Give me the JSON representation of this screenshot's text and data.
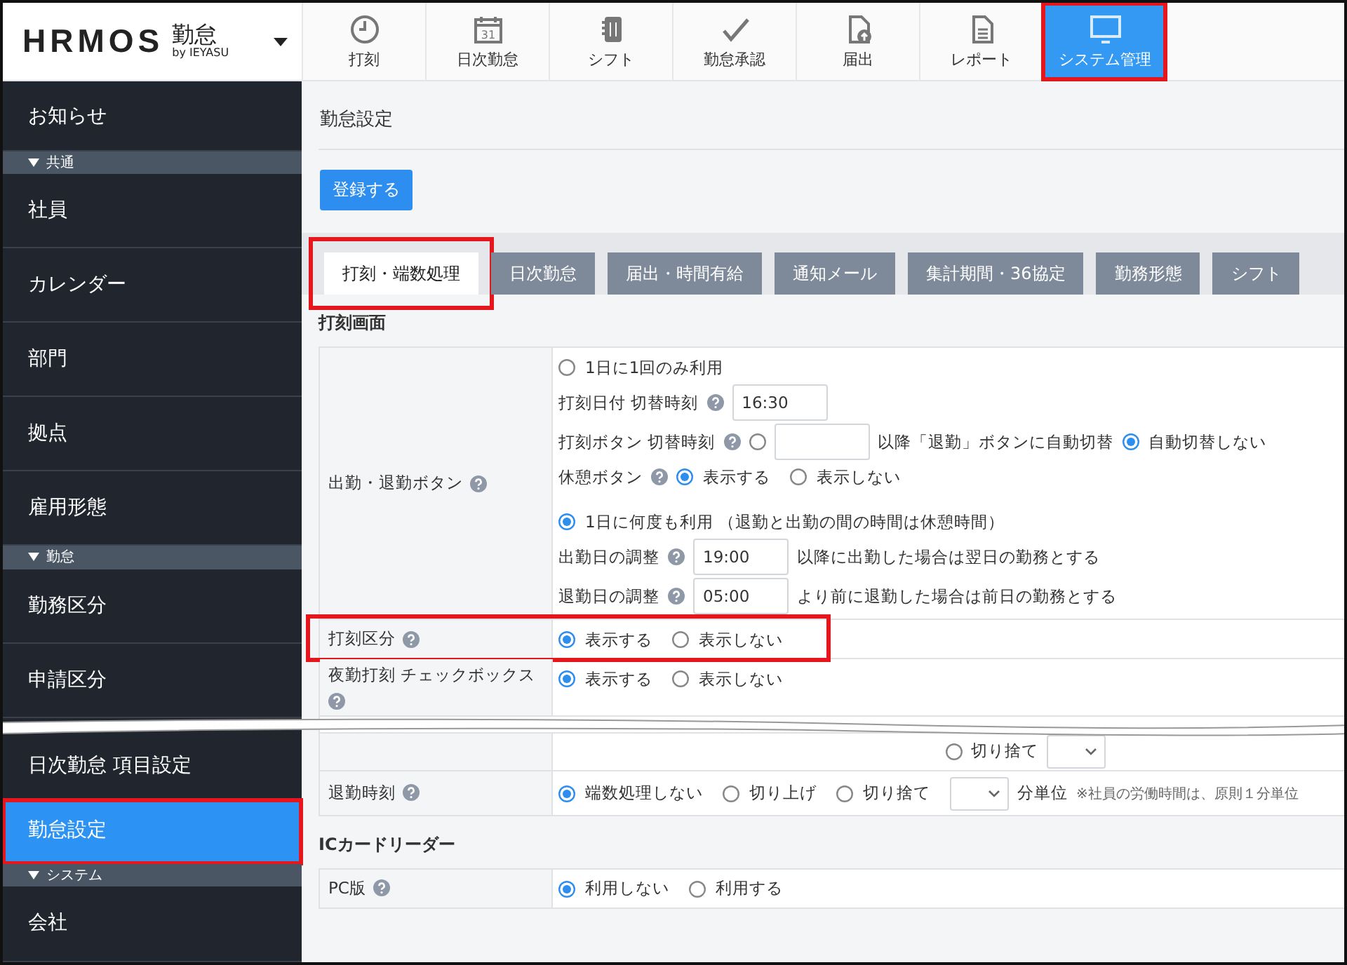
{
  "header": {
    "logo": {
      "brand": "HRMOS",
      "product": "勤怠",
      "by": "by IEYASU"
    },
    "nav": [
      {
        "kind": "clock",
        "label": "打刻",
        "selected": false,
        "highlighted": false
      },
      {
        "kind": "calendar",
        "label": "日次勤怠",
        "icon_text": "31",
        "selected": false,
        "highlighted": false
      },
      {
        "kind": "notebook",
        "label": "シフト",
        "selected": false,
        "highlighted": false
      },
      {
        "kind": "check",
        "label": "勤怠承認",
        "selected": false,
        "highlighted": false
      },
      {
        "kind": "upload",
        "label": "届出",
        "selected": false,
        "highlighted": false
      },
      {
        "kind": "document",
        "label": "レポート",
        "selected": false,
        "highlighted": false
      },
      {
        "kind": "monitor",
        "label": "システム管理",
        "selected": true,
        "highlighted": true
      }
    ]
  },
  "sidebar": {
    "items": [
      {
        "kind": "item",
        "label": "お知らせ",
        "selected": false,
        "highlighted": false
      },
      {
        "kind": "section",
        "label": "共通"
      },
      {
        "kind": "item",
        "label": "社員",
        "selected": false,
        "highlighted": false
      },
      {
        "kind": "item",
        "label": "カレンダー",
        "selected": false,
        "highlighted": false
      },
      {
        "kind": "item",
        "label": "部門",
        "selected": false,
        "highlighted": false
      },
      {
        "kind": "item",
        "label": "拠点",
        "selected": false,
        "highlighted": false
      },
      {
        "kind": "item",
        "label": "雇用形態",
        "selected": false,
        "highlighted": false
      },
      {
        "kind": "section",
        "label": "勤怠"
      },
      {
        "kind": "item",
        "label": "勤務区分",
        "selected": false,
        "highlighted": false
      },
      {
        "kind": "item",
        "label": "申請区分",
        "selected": false,
        "highlighted": false
      },
      {
        "kind": "break"
      },
      {
        "kind": "item",
        "label": "日次勤怠 項目設定",
        "selected": false,
        "highlighted": false
      },
      {
        "kind": "item",
        "label": "勤怠設定",
        "selected": true,
        "highlighted": true
      },
      {
        "kind": "section",
        "label": "システム"
      },
      {
        "kind": "item",
        "label": "会社",
        "selected": false,
        "highlighted": false
      }
    ]
  },
  "content": {
    "title": "勤怠設定",
    "submit_button": "登録する",
    "tabs": [
      {
        "label": "打刻・端数処理",
        "selected": true,
        "highlighted": true
      },
      {
        "label": "日次勤怠",
        "selected": false,
        "highlighted": false
      },
      {
        "label": "届出・時間有給",
        "selected": false,
        "highlighted": false
      },
      {
        "label": "通知メール",
        "selected": false,
        "highlighted": false
      },
      {
        "label": "集計期間・36協定",
        "selected": false,
        "highlighted": false
      },
      {
        "label": "勤務形態",
        "selected": false,
        "highlighted": false
      },
      {
        "label": "シフト",
        "selected": false,
        "highlighted": false
      }
    ],
    "sections": [
      {
        "title": "打刻画面",
        "rows": [
          {
            "kind": "setting",
            "label": "出勤・退勤ボタン",
            "help": true,
            "lines": [
              [
                {
                  "kind": "radio",
                  "label": "1日に1回のみ利用",
                  "selected": false
                }
              ],
              [
                {
                  "kind": "text",
                  "text": "打刻日付 切替時刻"
                },
                {
                  "kind": "help"
                },
                {
                  "kind": "input",
                  "value": "16:30"
                }
              ],
              [
                {
                  "kind": "text",
                  "text": "打刻ボタン 切替時刻"
                },
                {
                  "kind": "help"
                },
                {
                  "kind": "radio",
                  "selected": false
                },
                {
                  "kind": "input"
                },
                {
                  "kind": "text",
                  "text": "以降「退勤」ボタンに自動切替"
                },
                {
                  "kind": "radio",
                  "label": "自動切替しない",
                  "selected": true
                }
              ],
              [
                {
                  "kind": "text",
                  "text": "休憩ボタン"
                },
                {
                  "kind": "help"
                },
                {
                  "kind": "radio",
                  "label": "表示する",
                  "selected": true
                },
                {
                  "kind": "radio",
                  "label": "表示しない",
                  "selected": false
                }
              ],
              [
                {
                  "kind": "gap"
                }
              ],
              [
                {
                  "kind": "radio",
                  "label": "1日に何度も利用 （退勤と出勤の間の時間は休憩時間）",
                  "selected": true
                }
              ],
              [
                {
                  "kind": "text",
                  "text": "出勤日の調整"
                },
                {
                  "kind": "help"
                },
                {
                  "kind": "input",
                  "value": "19:00"
                },
                {
                  "kind": "text",
                  "text": "以降に出勤した場合は翌日の勤務とする"
                }
              ],
              [
                {
                  "kind": "text",
                  "text": "退勤日の調整"
                },
                {
                  "kind": "help"
                },
                {
                  "kind": "input",
                  "value": "05:00"
                },
                {
                  "kind": "text",
                  "text": "より前に退勤した場合は前日の勤務とする"
                }
              ]
            ]
          },
          {
            "kind": "setting",
            "label": "打刻区分",
            "help": true,
            "highlighted": true,
            "lines": [
              [
                {
                  "kind": "radio",
                  "label": "表示する",
                  "selected": true
                },
                {
                  "kind": "radio",
                  "label": "表示しない",
                  "selected": false
                }
              ]
            ]
          },
          {
            "kind": "setting",
            "label": "夜勤打刻 チェックボックス",
            "help": true,
            "lines": [
              [
                {
                  "kind": "radio",
                  "label": "表示する",
                  "selected": true
                },
                {
                  "kind": "radio",
                  "label": "表示しない",
                  "selected": false
                }
              ]
            ]
          },
          {
            "kind": "break"
          },
          {
            "kind": "partial",
            "lines": [
              [
                {
                  "kind": "radio",
                  "selected": false
                },
                {
                  "kind": "text",
                  "text": "切り捨て"
                },
                {
                  "kind": "select"
                }
              ]
            ]
          },
          {
            "kind": "setting",
            "label": "退勤時刻",
            "help": true,
            "lines": [
              [
                {
                  "kind": "radio",
                  "label": "端数処理しない",
                  "selected": true
                },
                {
                  "kind": "radio",
                  "label": "切り上げ",
                  "selected": false
                },
                {
                  "kind": "radio",
                  "label": "切り捨て",
                  "selected": false
                },
                {
                  "kind": "select"
                },
                {
                  "kind": "text",
                  "text": "分単位"
                },
                {
                  "kind": "note",
                  "text": "※社員の労働時間は、原則１分単位"
                }
              ]
            ]
          }
        ]
      },
      {
        "title": "ICカードリーダー",
        "rows": [
          {
            "kind": "setting",
            "label": "PC版",
            "help": true,
            "lines": [
              [
                {
                  "kind": "radio",
                  "label": "利用しない",
                  "selected": true
                },
                {
                  "kind": "radio",
                  "label": "利用する",
                  "selected": false
                }
              ]
            ]
          }
        ]
      }
    ]
  }
}
